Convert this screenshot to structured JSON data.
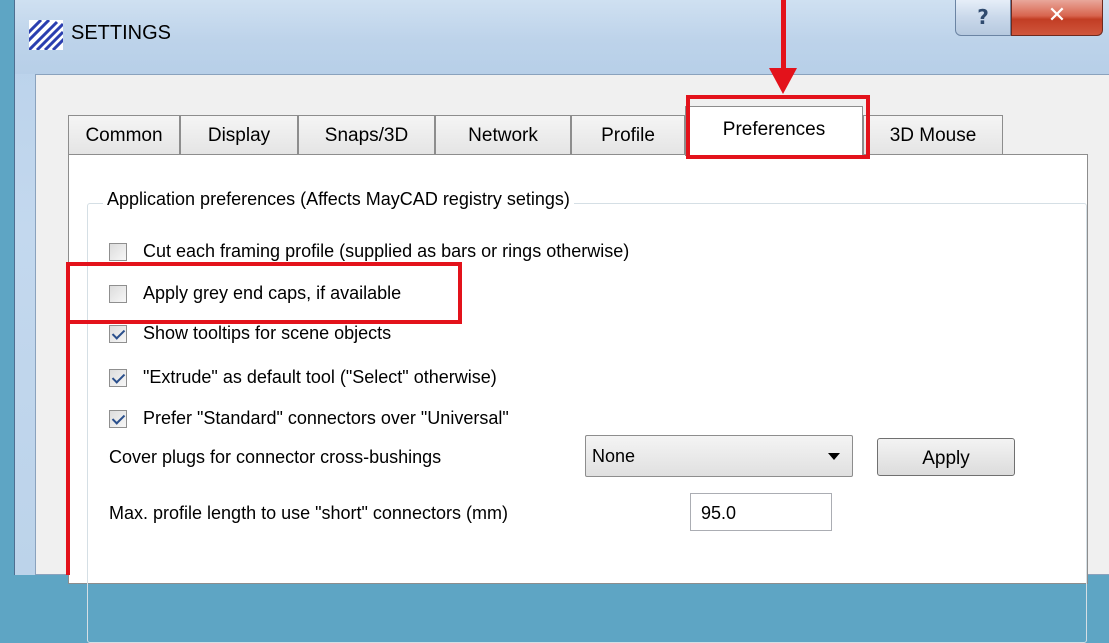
{
  "window": {
    "title": "SETTINGS",
    "help_glyph": "?",
    "close_glyph": "✕"
  },
  "tabs": [
    {
      "label": "Common",
      "active": false
    },
    {
      "label": "Display",
      "active": false
    },
    {
      "label": "Snaps/3D",
      "active": false
    },
    {
      "label": "Network",
      "active": false
    },
    {
      "label": "Profile",
      "active": false
    },
    {
      "label": "Preferences",
      "active": true
    },
    {
      "label": "3D Mouse",
      "active": false
    }
  ],
  "preferences": {
    "group_label": "Application preferences (Affects MayCAD registry setings)",
    "options": [
      {
        "label": "Cut each framing profile (supplied as bars or rings otherwise)",
        "checked": false
      },
      {
        "label": "Apply grey end caps, if available",
        "checked": false
      },
      {
        "label": "Show tooltips for scene objects",
        "checked": true
      },
      {
        "label": "\"Extrude\" as default tool (\"Select\" otherwise)",
        "checked": true
      },
      {
        "label": "Prefer \"Standard\" connectors over \"Universal\"",
        "checked": true
      }
    ],
    "cover_plugs": {
      "label": "Cover plugs for connector cross-bushings",
      "value": "None",
      "apply_label": "Apply"
    },
    "max_profile": {
      "label": "Max. profile length to use \"short\" connectors (mm)",
      "value": "95.0"
    }
  },
  "annotations": {
    "highlight_color": "#e3121b",
    "highlighted_tab": "Preferences",
    "highlighted_option": "Apply grey end caps, if available"
  },
  "colors": {
    "desktop": "#5ea5c4",
    "title_bar": "#bdd3ea",
    "close_button": "#c23d24"
  }
}
